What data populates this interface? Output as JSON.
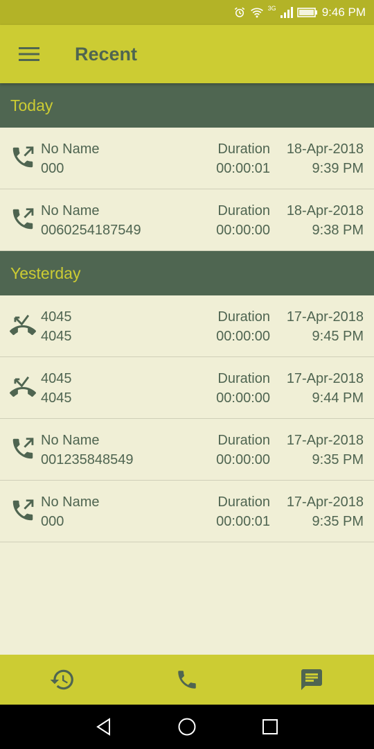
{
  "status_bar": {
    "time": "9:46 PM",
    "network": "3G"
  },
  "app_bar": {
    "title": "Recent"
  },
  "sections": [
    {
      "title": "Today",
      "calls": [
        {
          "type": "outgoing",
          "name": "No Name",
          "number": "000",
          "duration_label": "Duration",
          "duration": "00:00:01",
          "date": "18-Apr-2018",
          "time": "9:39 PM"
        },
        {
          "type": "outgoing",
          "name": "No Name",
          "number": "0060254187549",
          "duration_label": "Duration",
          "duration": "00:00:00",
          "date": "18-Apr-2018",
          "time": "9:38 PM"
        }
      ]
    },
    {
      "title": "Yesterday",
      "calls": [
        {
          "type": "missed",
          "name": "4045",
          "number": "4045",
          "duration_label": "Duration",
          "duration": "00:00:00",
          "date": "17-Apr-2018",
          "time": "9:45 PM"
        },
        {
          "type": "missed",
          "name": "4045",
          "number": "4045",
          "duration_label": "Duration",
          "duration": "00:00:00",
          "date": "17-Apr-2018",
          "time": "9:44 PM"
        },
        {
          "type": "outgoing",
          "name": "No Name",
          "number": "001235848549",
          "duration_label": "Duration",
          "duration": "00:00:00",
          "date": "17-Apr-2018",
          "time": "9:35 PM"
        },
        {
          "type": "outgoing",
          "name": "No Name",
          "number": "000",
          "duration_label": "Duration",
          "duration": "00:00:01",
          "date": "17-Apr-2018",
          "time": "9:35 PM"
        }
      ]
    }
  ],
  "bottom_nav": [
    {
      "icon": "history-icon"
    },
    {
      "icon": "phone-icon"
    },
    {
      "icon": "message-icon"
    }
  ],
  "colors": {
    "status_bar": "#b3b327",
    "app_bar": "#cccc33",
    "section_header": "#4f6651",
    "section_text": "#cccc33",
    "background": "#f0efd6",
    "text": "#4f6551"
  }
}
